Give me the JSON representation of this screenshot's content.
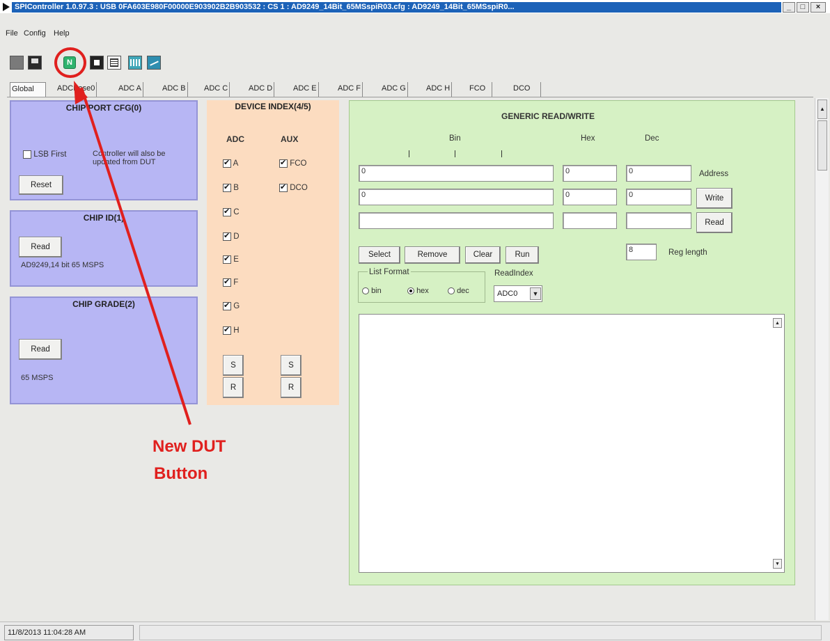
{
  "window": {
    "title": "SPIController 1.0.97.3 : USB 0FA603E980F00000E903902B2B903532 : CS 1 : AD9249_14Bit_65MSspiR03.cfg : AD9249_14Bit_65MSspiR0..."
  },
  "menu": [
    "File",
    "Config",
    "Help"
  ],
  "tabs": [
    "Global",
    "ADCBase0",
    "ADC A",
    "ADC B",
    "ADC C",
    "ADC D",
    "ADC E",
    "ADC F",
    "ADC G",
    "ADC H",
    "FCO",
    "DCO"
  ],
  "chip_port_cfg": {
    "title": "CHIP PORT CFG(0)",
    "lsb_label": "LSB First",
    "note": "Controller will also be updated from DUT",
    "reset_label": "Reset"
  },
  "chip_id": {
    "title": "CHIP ID(1)",
    "read_label": "Read",
    "value": "AD9249,14 bit 65 MSPS"
  },
  "chip_grade": {
    "title": "CHIP GRADE(2)",
    "read_label": "Read",
    "value": "65 MSPS"
  },
  "device_index": {
    "title": "DEVICE INDEX(4/5)",
    "adc_header": "ADC",
    "aux_header": "AUX",
    "adc_items": [
      "A",
      "B",
      "C",
      "D",
      "E",
      "F",
      "G",
      "H"
    ],
    "aux_items": [
      "FCO",
      "DCO"
    ],
    "s_label": "S",
    "r_label": "R"
  },
  "generic_rw": {
    "title": "GENERIC READ/WRITE",
    "bin_header": "Bin",
    "hex_header": "Hex",
    "dec_header": "Dec",
    "address_row": {
      "bin": "0",
      "hex": "0",
      "dec": "0"
    },
    "data_row": {
      "bin": "0",
      "hex": "0",
      "dec": "0"
    },
    "address_label": "Address",
    "write_label": "Write",
    "read_label": "Read",
    "select_label": "Select",
    "remove_label": "Remove",
    "clear_label": "Clear",
    "run_label": "Run",
    "reg_length_value": "8",
    "reg_length_label": "Reg length",
    "list_format_label": "List Format",
    "formats": [
      "bin",
      "hex",
      "dec"
    ],
    "read_index_label": "ReadIndex",
    "read_index_value": "ADC0"
  },
  "annotation": {
    "line1": "New DUT",
    "line2": "Button",
    "color": "#e0201e"
  },
  "status": {
    "timestamp": "11/8/2013 11:04:28 AM"
  }
}
